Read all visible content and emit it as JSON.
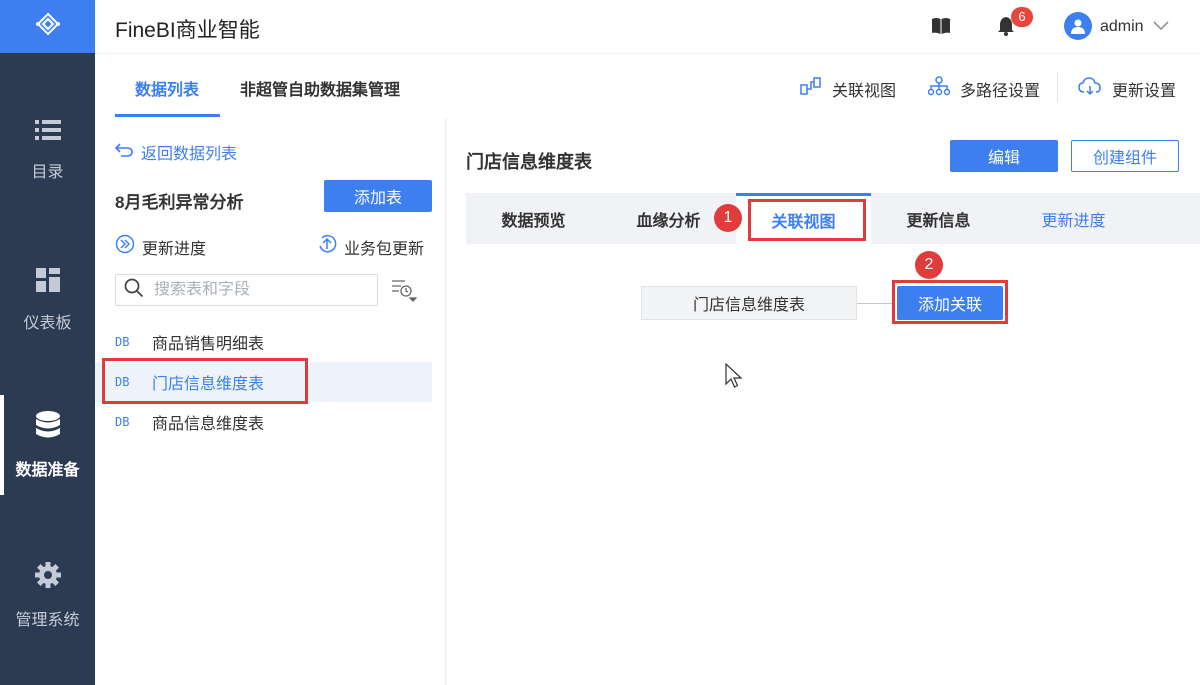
{
  "app": {
    "title": "FineBI商业智能"
  },
  "header": {
    "notification_count": "6",
    "user_name": "admin"
  },
  "nav": {
    "items": [
      {
        "label": "目录",
        "icon": "list-icon"
      },
      {
        "label": "仪表板",
        "icon": "dashboard-icon"
      },
      {
        "label": "数据准备",
        "icon": "database-icon",
        "active": true
      },
      {
        "label": "管理系统",
        "icon": "gear-icon"
      }
    ]
  },
  "top_tabs": [
    {
      "label": "数据列表",
      "active": true
    },
    {
      "label": "非超管自助数据集管理"
    }
  ],
  "toolbar": {
    "relation_view": "关联视图",
    "multipath": "多路径设置",
    "update_settings": "更新设置"
  },
  "left_panel": {
    "back_label": "返回数据列表",
    "package_name": "8月毛利异常分析",
    "add_table_label": "添加表",
    "update_progress_label": "更新进度",
    "package_update_label": "业务包更新",
    "search_placeholder": "搜索表和字段",
    "db_tag": "DB",
    "tables": [
      {
        "name": "商品销售明细表"
      },
      {
        "name": "门店信息维度表",
        "selected": true
      },
      {
        "name": "商品信息维度表"
      }
    ]
  },
  "detail": {
    "title": "门店信息维度表",
    "edit_label": "编辑",
    "create_component_label": "创建组件",
    "tabs": [
      {
        "label": "数据预览"
      },
      {
        "label": "血缘分析"
      },
      {
        "label": "关联视图",
        "active": true
      },
      {
        "label": "更新信息"
      }
    ],
    "update_progress_link": "更新进度",
    "node_label": "门店信息维度表",
    "add_relation_label": "添加关联"
  },
  "annotations": {
    "step1": "1",
    "step2": "2"
  },
  "colors": {
    "accent": "#3d7ff0",
    "nav_bg": "#2c3a52",
    "highlight": "#e13c3c"
  }
}
